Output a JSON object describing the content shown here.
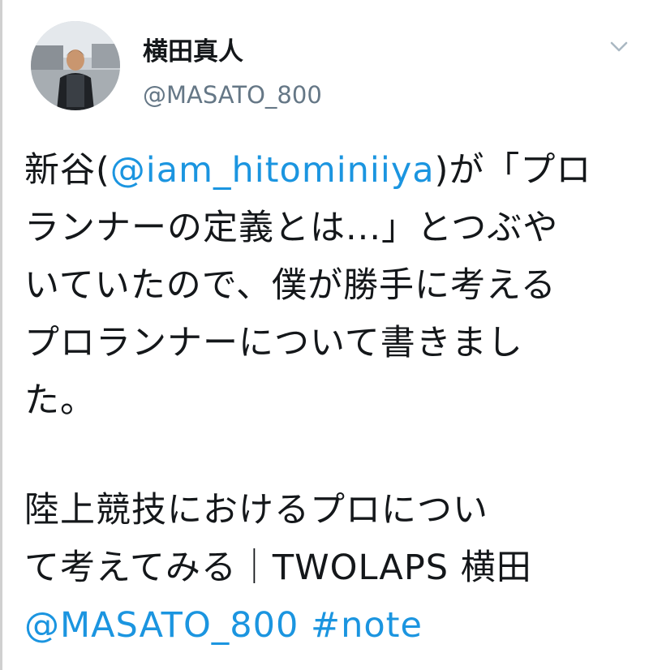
{
  "author": {
    "name": "横田真人",
    "handle": "@MASATO_800"
  },
  "icons": {
    "avatar": "avatar-photo",
    "menu": "chevron-down-icon"
  },
  "colors": {
    "link": "#1b95e0",
    "text": "#14171a",
    "secondary": "#657786"
  },
  "tweet": {
    "paragraph1": {
      "prefix": "新谷(",
      "mention": "@iam_hitominiiya",
      "line1_end": ")が「プロ",
      "line2": "ランナーの定義とは...」とつぶや",
      "line3": "いていたので、僕が勝手に考える",
      "line4": "プロランナーについて書きまし",
      "line5": "た。"
    },
    "paragraph2": {
      "line1": "陸上競技におけるプロについ",
      "line2": "て考えてみる｜TWOLAPS 横田",
      "mention": "@MASATO_800",
      "hashtag": "#note"
    }
  }
}
